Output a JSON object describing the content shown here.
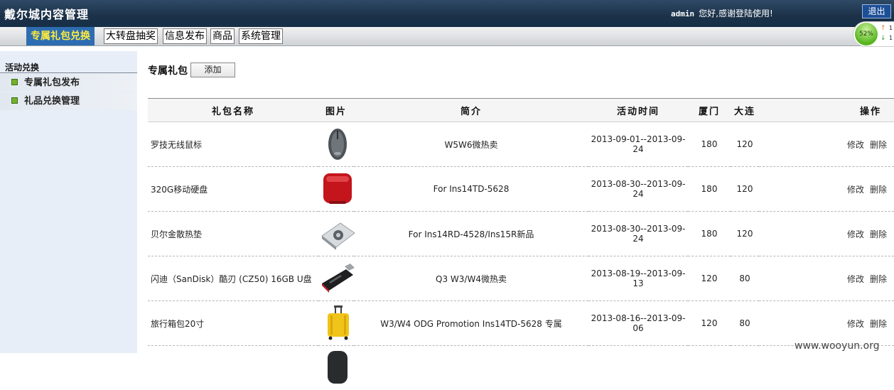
{
  "header": {
    "title": "戴尔城内容管理",
    "user": "admin",
    "greeting": "您好,感谢登陆使用!",
    "logout_label": "退出"
  },
  "nav": {
    "tabs": [
      {
        "label": "专属礼包兑换"
      },
      {
        "label": "大转盘抽奖"
      },
      {
        "label": "信息发布"
      },
      {
        "label": "商品"
      },
      {
        "label": "系统管理"
      }
    ]
  },
  "monitor": {
    "percent": "52%",
    "up": "1",
    "down": "1"
  },
  "sidebar": {
    "section_title": "活动兑换",
    "items": [
      {
        "label": "专属礼包发布"
      },
      {
        "label": "礼品兑换管理"
      }
    ]
  },
  "main": {
    "title": "专属礼包",
    "add_label": "添加",
    "columns": [
      "礼包名称",
      "图片",
      "简介",
      "活动时间",
      "厦门",
      "大连",
      "操作"
    ],
    "rows": [
      {
        "name": "罗技无线鼠标",
        "image": "mouse-icon",
        "intro": "W5W6微热卖",
        "period": "2013-09-01--2013-09-24",
        "xiamen": "180",
        "dalian": "120",
        "edit": "修改",
        "delete": "删除"
      },
      {
        "name": "320G移动硬盘",
        "image": "hard-drive-icon",
        "intro": "For Ins14TD-5628",
        "period": "2013-08-30--2013-09-24",
        "xiamen": "180",
        "dalian": "120",
        "edit": "修改",
        "delete": "删除"
      },
      {
        "name": "贝尔金散热垫",
        "image": "cooling-pad-icon",
        "intro": "For Ins14RD-4528/Ins15R新品",
        "period": "2013-08-30--2013-09-24",
        "xiamen": "180",
        "dalian": "120",
        "edit": "修改",
        "delete": "删除"
      },
      {
        "name": "闪迪（SanDisk）酷刃 (CZ50) 16GB U盘",
        "image": "usb-drive-icon",
        "intro": "Q3 W3/W4微热卖",
        "period": "2013-08-19--2013-09-13",
        "xiamen": "120",
        "dalian": "80",
        "edit": "修改",
        "delete": "删除"
      },
      {
        "name": "旅行箱包20寸",
        "image": "suitcase-icon",
        "intro": "W3/W4 ODG Promotion Ins14TD-5628 专属",
        "period": "2013-08-16--2013-09-06",
        "xiamen": "120",
        "dalian": "80",
        "edit": "修改",
        "delete": "删除"
      }
    ]
  },
  "watermark": "www.wooyun.org"
}
